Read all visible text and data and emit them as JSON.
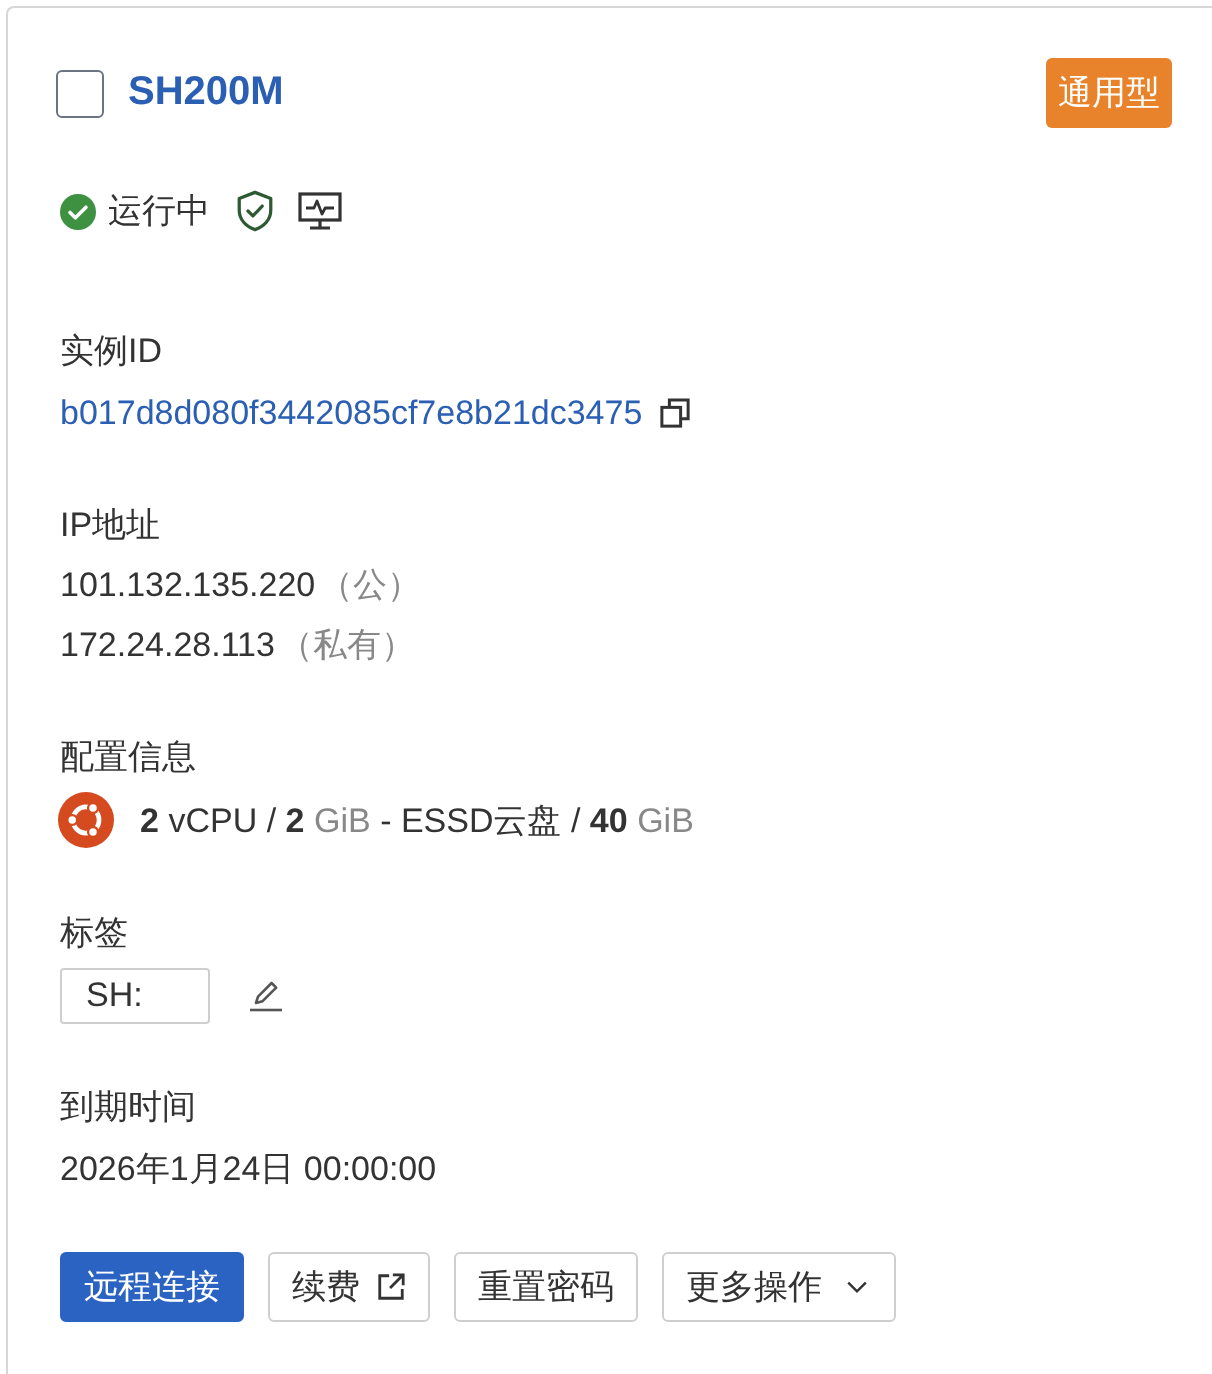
{
  "instance": {
    "checked": false,
    "name": "SH200M",
    "badge": "通用型"
  },
  "status": {
    "label": "运行中",
    "kind": "running"
  },
  "fields": [
    {
      "label": "实例ID",
      "kind": "id",
      "value": "b017d8d080f3442085cf7e8b21dc3475"
    },
    {
      "label": "IP地址",
      "kind": "ips",
      "lines": [
        {
          "address": "101.132.135.220",
          "note": "（公）"
        },
        {
          "address": "172.24.28.113",
          "note": "（私有）"
        }
      ]
    },
    {
      "label": "配置信息",
      "kind": "spec",
      "parts": [
        {
          "text": "2",
          "kind": "num"
        },
        {
          "text": "vCPU /",
          "kind": "text"
        },
        {
          "text": "2",
          "kind": "num"
        },
        {
          "text": "GiB",
          "kind": "unit"
        },
        {
          "text": "- ESSD云盘 /",
          "kind": "text"
        },
        {
          "text": "40",
          "kind": "num"
        },
        {
          "text": "GiB",
          "kind": "unit"
        }
      ]
    },
    {
      "label": "标签",
      "kind": "tags",
      "tags": [
        "SH:"
      ]
    },
    {
      "label": "到期时间",
      "kind": "text",
      "value": "2026年1月24日 00:00:00"
    }
  ],
  "actions": [
    {
      "label": "远程连接",
      "kind": "primary"
    },
    {
      "label": "续费",
      "kind": "external"
    },
    {
      "label": "重置密码",
      "kind": "plain"
    },
    {
      "label": "更多操作",
      "kind": "dropdown"
    }
  ]
}
